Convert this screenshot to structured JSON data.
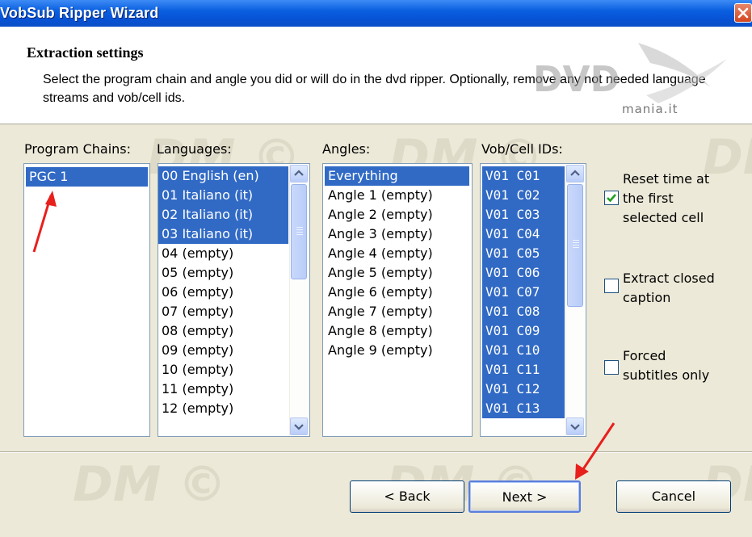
{
  "window": {
    "title": "VobSub Ripper Wizard",
    "close_icon": "close-icon"
  },
  "header": {
    "title": "Extraction settings",
    "description": "Select the program chain and angle you did or will do in the dvd ripper. Optionally, remove any not needed language streams and vob/cell ids.",
    "logo_text": "DVD",
    "logo_subtext": "mania.it"
  },
  "watermark": "DM ©",
  "program_chains": {
    "label": "Program Chains:",
    "items": [
      "PGC 1"
    ]
  },
  "languages": {
    "label": "Languages:",
    "items": [
      "00 English (en)",
      "01 Italiano (it)",
      "02 Italiano (it)",
      "03 Italiano (it)",
      "04 (empty)",
      "05 (empty)",
      "06 (empty)",
      "07 (empty)",
      "08 (empty)",
      "09 (empty)",
      "10 (empty)",
      "11 (empty)",
      "12 (empty)"
    ]
  },
  "angles": {
    "label": "Angles:",
    "items": [
      "Everything",
      "Angle 1 (empty)",
      "Angle 2 (empty)",
      "Angle 3 (empty)",
      "Angle 4 (empty)",
      "Angle 5 (empty)",
      "Angle 6 (empty)",
      "Angle 7 (empty)",
      "Angle 8 (empty)",
      "Angle 9 (empty)"
    ]
  },
  "vob_cells": {
    "label": "Vob/Cell IDs:",
    "items": [
      "V01 C01",
      "V01 C02",
      "V01 C03",
      "V01 C04",
      "V01 C05",
      "V01 C06",
      "V01 C07",
      "V01 C08",
      "V01 C09",
      "V01 C10",
      "V01 C11",
      "V01 C12",
      "V01 C13"
    ]
  },
  "options": {
    "reset_time": {
      "label": "Reset time at\nthe first\nselected cell",
      "checked": true
    },
    "closed_caption": {
      "label": "Extract closed\ncaption",
      "checked": false
    },
    "forced_subs": {
      "label": "Forced\nsubtitles only",
      "checked": false
    }
  },
  "buttons": {
    "back": "< Back",
    "next": "Next >",
    "cancel": "Cancel"
  },
  "colors": {
    "selection": "#316ac5",
    "titlebar": "#0a5fe0",
    "annotation_arrow": "#e8201c"
  }
}
